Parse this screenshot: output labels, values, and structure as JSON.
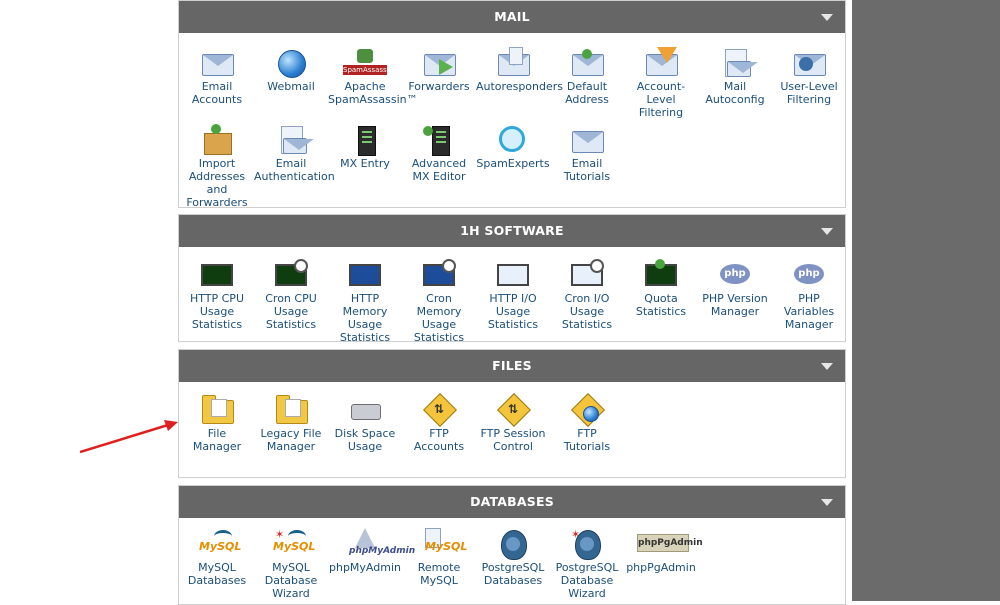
{
  "panels": {
    "mail": {
      "title": "MAIL",
      "items": [
        {
          "l1": "Email",
          "l2": "Accounts",
          "icon": "email-accounts-icon"
        },
        {
          "l1": "Webmail",
          "icon": "webmail-icon"
        },
        {
          "l1": "Apache",
          "l2": "SpamAssassin™",
          "icon": "spamassassin-icon"
        },
        {
          "l1": "Forwarders",
          "icon": "forwarders-icon"
        },
        {
          "l1": "Autoresponders",
          "icon": "autoresponders-icon"
        },
        {
          "l1": "Default",
          "l2": "Address",
          "icon": "default-address-icon"
        },
        {
          "l1": "Account-",
          "l2": "Level",
          "l3": "Filtering",
          "icon": "account-filter-icon"
        },
        {
          "l1": "Mail",
          "l2": "Autoconfig",
          "icon": "mail-autoconfig-icon"
        },
        {
          "l1": "User-Level",
          "l2": "Filtering",
          "icon": "user-filter-icon"
        },
        {
          "l1": "Import",
          "l2": "Addresses",
          "l3": "and",
          "l4": "Forwarders",
          "icon": "import-icon"
        },
        {
          "l1": "Email",
          "l2": "Authentication",
          "icon": "email-auth-icon"
        },
        {
          "l1": "MX Entry",
          "icon": "mx-entry-icon"
        },
        {
          "l1": "Advanced",
          "l2": "MX Editor",
          "icon": "mx-editor-icon"
        },
        {
          "l1": "SpamExperts",
          "icon": "spamexperts-icon"
        },
        {
          "l1": "Email",
          "l2": "Tutorials",
          "icon": "email-tutorials-icon"
        }
      ]
    },
    "software": {
      "title": "1H SOFTWARE",
      "items": [
        {
          "l1": "HTTP CPU",
          "l2": "Usage",
          "l3": "Statistics",
          "icon": "http-cpu-icon"
        },
        {
          "l1": "Cron CPU",
          "l2": "Usage",
          "l3": "Statistics",
          "icon": "cron-cpu-icon"
        },
        {
          "l1": "HTTP",
          "l2": "Memory",
          "l3": "Usage",
          "l4": "Statistics",
          "icon": "http-memory-icon"
        },
        {
          "l1": "Cron",
          "l2": "Memory",
          "l3": "Usage",
          "l4": "Statistics",
          "icon": "cron-memory-icon"
        },
        {
          "l1": "HTTP I/O",
          "l2": "Usage",
          "l3": "Statistics",
          "icon": "http-io-icon"
        },
        {
          "l1": "Cron I/O",
          "l2": "Usage",
          "l3": "Statistics",
          "icon": "cron-io-icon"
        },
        {
          "l1": "Quota",
          "l2": "Statistics",
          "icon": "quota-icon"
        },
        {
          "l1": "PHP Version",
          "l2": "Manager",
          "icon": "php-version-icon"
        },
        {
          "l1": "PHP",
          "l2": "Variables",
          "l3": "Manager",
          "icon": "php-variables-icon"
        }
      ]
    },
    "files": {
      "title": "FILES",
      "items": [
        {
          "l1": "File",
          "l2": "Manager",
          "icon": "file-manager-icon"
        },
        {
          "l1": "Legacy File",
          "l2": "Manager",
          "icon": "legacy-file-manager-icon"
        },
        {
          "l1": "Disk Space",
          "l2": "Usage",
          "icon": "disk-space-icon"
        },
        {
          "l1": "FTP",
          "l2": "Accounts",
          "icon": "ftp-accounts-icon"
        },
        {
          "l1": "FTP Session",
          "l2": "Control",
          "icon": "ftp-session-icon"
        },
        {
          "l1": "FTP",
          "l2": "Tutorials",
          "icon": "ftp-tutorials-icon"
        }
      ]
    },
    "databases": {
      "title": "DATABASES",
      "items": [
        {
          "l1": "MySQL",
          "l2": "Databases",
          "icon": "mysql-icon"
        },
        {
          "l1": "MySQL",
          "l2": "Database",
          "l3": "Wizard",
          "icon": "mysql-wizard-icon"
        },
        {
          "l1": "phpMyAdmin",
          "icon": "phpmyadmin-icon"
        },
        {
          "l1": "Remote",
          "l2": "MySQL",
          "icon": "remote-mysql-icon"
        },
        {
          "l1": "PostgreSQL",
          "l2": "Databases",
          "icon": "postgresql-icon"
        },
        {
          "l1": "PostgreSQL",
          "l2": "Database",
          "l3": "Wizard",
          "icon": "postgresql-wizard-icon"
        },
        {
          "l1": "phpPgAdmin",
          "icon": "phppgadmin-icon"
        }
      ]
    }
  },
  "icon_text": {
    "spamassassin": "SpamAssassin",
    "php": "php",
    "mysql_a": "My",
    "mysql_b": "SQL",
    "pma": "phpMyAdmin",
    "pgadmin": "phpPgAdmin"
  },
  "colors": {
    "header_bg": "#666666",
    "label_text": "#1b4f7a",
    "annotation_arrow": "#e02020"
  }
}
